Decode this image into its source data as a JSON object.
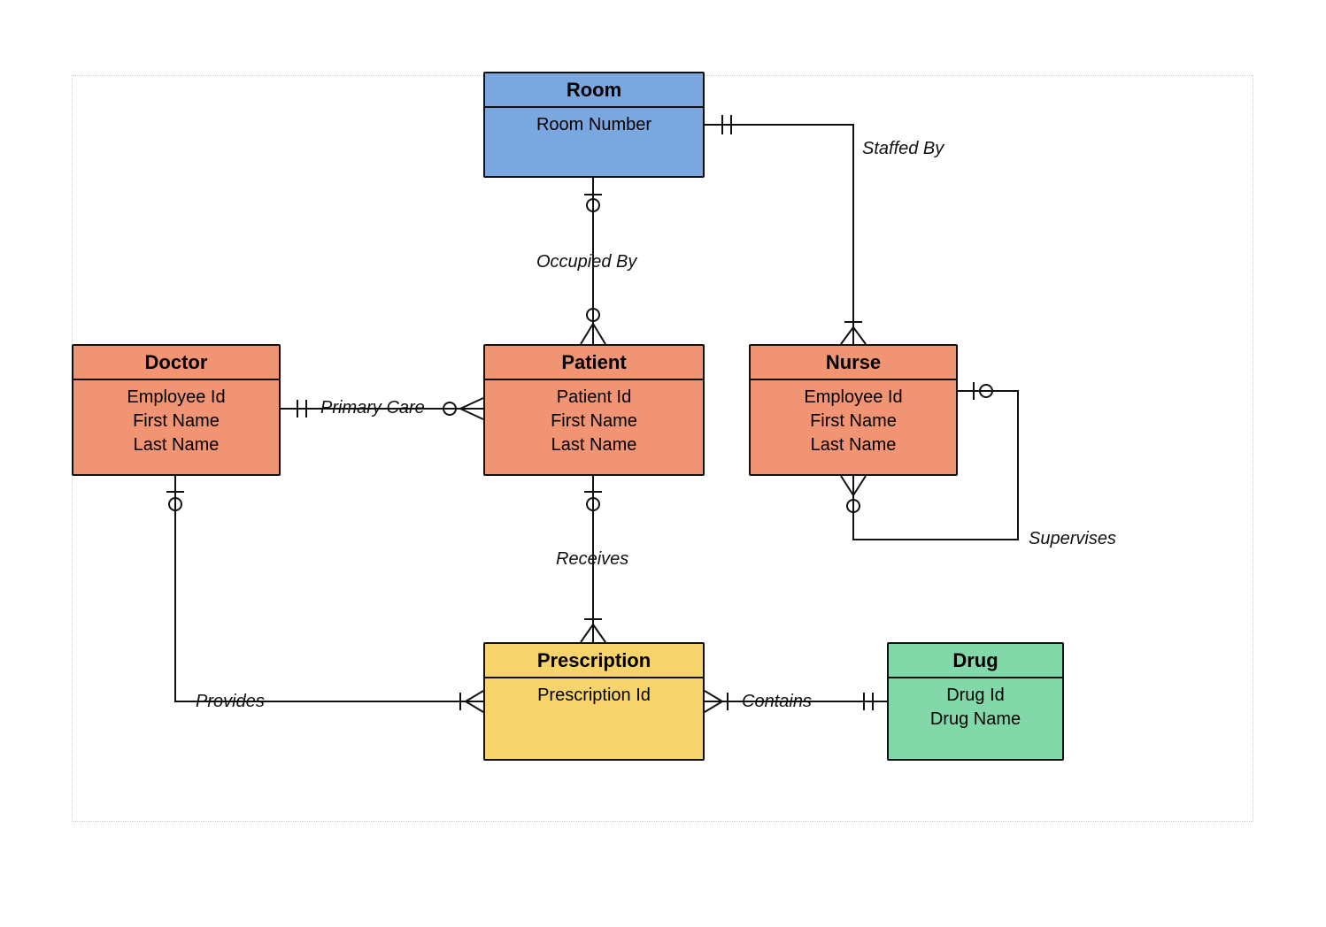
{
  "entities": {
    "room": {
      "title": "Room",
      "attrs": [
        "Room Number"
      ]
    },
    "patient": {
      "title": "Patient",
      "attrs": [
        "Patient Id",
        "First Name",
        "Last Name"
      ]
    },
    "doctor": {
      "title": "Doctor",
      "attrs": [
        "Employee Id",
        "First Name",
        "Last Name"
      ]
    },
    "nurse": {
      "title": "Nurse",
      "attrs": [
        "Employee Id",
        "First Name",
        "Last Name"
      ]
    },
    "prescription": {
      "title": "Prescription",
      "attrs": [
        "Prescription Id"
      ]
    },
    "drug": {
      "title": "Drug",
      "attrs": [
        "Drug Id",
        "Drug Name"
      ]
    }
  },
  "relationships": {
    "staffed_by": "Staffed By",
    "occupied_by": "Occupied By",
    "primary_care": "Primary Care",
    "receives": "Receives",
    "provides": "Provides",
    "contains": "Contains",
    "supervises": "Supervises"
  }
}
